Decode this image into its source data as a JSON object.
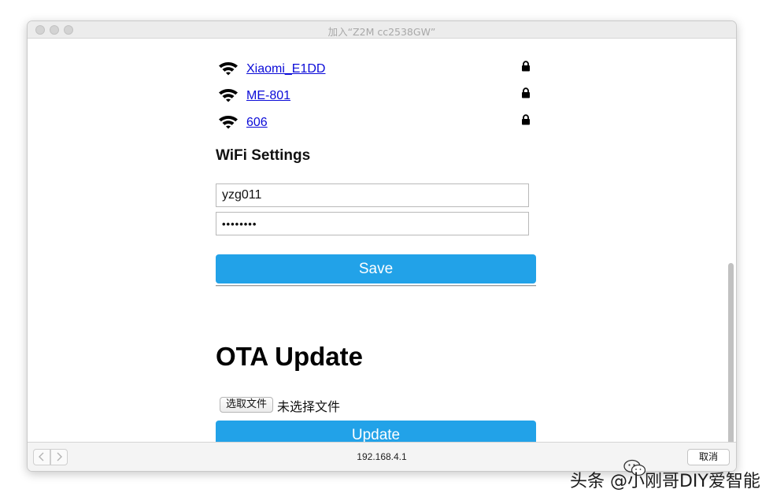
{
  "window": {
    "title": "加入“Z2M cc2538GW”"
  },
  "networks": [
    {
      "name": "Xiaomi_E1DD",
      "icon": "wifi-icon",
      "secured_icon": "lock-icon"
    },
    {
      "name": "ME-801",
      "icon": "wifi-icon",
      "secured_icon": "lock-icon"
    },
    {
      "name": "606",
      "icon": "wifi-icon",
      "secured_icon": "lock-icon"
    }
  ],
  "wifi_settings": {
    "heading": "WiFi Settings",
    "ssid_value": "yzg011",
    "password_display": "••••••••",
    "save_label": "Save"
  },
  "ota": {
    "heading": "OTA Update",
    "choose_file_label": "选取文件",
    "file_status": "未选择文件",
    "update_label": "Update"
  },
  "bottombar": {
    "back_icon": "chevron-left-icon",
    "forward_icon": "chevron-right-icon",
    "url": "192.168.4.1",
    "cancel_label": "取消"
  },
  "watermark": {
    "text": "头条 @小刚哥DIY爱智能"
  },
  "colors": {
    "accent": "#22a2e8",
    "link": "#0b0bd8"
  }
}
